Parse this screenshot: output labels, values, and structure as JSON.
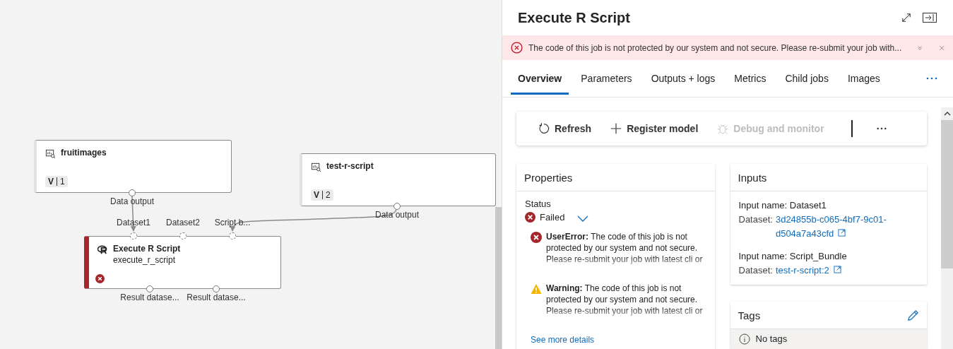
{
  "canvas": {
    "nodes": [
      {
        "kind": "dataset",
        "title": "fruitimages",
        "version_label": "V",
        "version": "1",
        "outputs": [
          "Data output"
        ]
      },
      {
        "kind": "dataset",
        "title": "test-r-script",
        "version_label": "V",
        "version": "2",
        "outputs": [
          "Data output"
        ]
      },
      {
        "kind": "module",
        "title": "Execute R Script",
        "subtitle": "execute_r_script",
        "failed": true,
        "inputs": [
          "Dataset1",
          "Dataset2",
          "Script b..."
        ],
        "outputs": [
          "Result datase...",
          "Result datase..."
        ]
      }
    ]
  },
  "panel": {
    "title": "Execute R Script",
    "banner": {
      "kind": "error",
      "message": "The code of this job is not protected by our system and not secure. Please re-submit your job with..."
    },
    "tabs": [
      {
        "label": "Overview",
        "selected": true
      },
      {
        "label": "Parameters",
        "selected": false
      },
      {
        "label": "Outputs + logs",
        "selected": false
      },
      {
        "label": "Metrics",
        "selected": false
      },
      {
        "label": "Child jobs",
        "selected": false
      },
      {
        "label": "Images",
        "selected": false
      }
    ],
    "toolbar": [
      {
        "kind": "refresh",
        "label": "Refresh",
        "disabled": false
      },
      {
        "kind": "add",
        "label": "Register model",
        "disabled": false
      },
      {
        "kind": "debug",
        "label": "Debug and monitor",
        "disabled": true
      }
    ],
    "properties": {
      "title": "Properties",
      "status_label": "Status",
      "status": "Failed",
      "messages": [
        {
          "kind": "error",
          "text": "**UserError:** The code of this job is not protected by our system and not secure. Please re-submit your job with latest cli or"
        },
        {
          "kind": "warning",
          "text": "**Warning:** The code of this job is not protected by our system and not secure. Please re-submit your job with latest cli or"
        }
      ],
      "link": "See more details"
    },
    "inputs": {
      "title": "Inputs",
      "items": [
        {
          "name": "Input name: Dataset1",
          "dataset_label": "Dataset:",
          "dataset": "3d24855b-c065-4bf7-9c01-d504a7a43cfd"
        },
        {
          "name": "Input name: Script_Bundle",
          "dataset_label": "Dataset:",
          "dataset": "test-r-script:2"
        }
      ]
    },
    "tags": {
      "title": "Tags",
      "empty": "No tags"
    }
  }
}
